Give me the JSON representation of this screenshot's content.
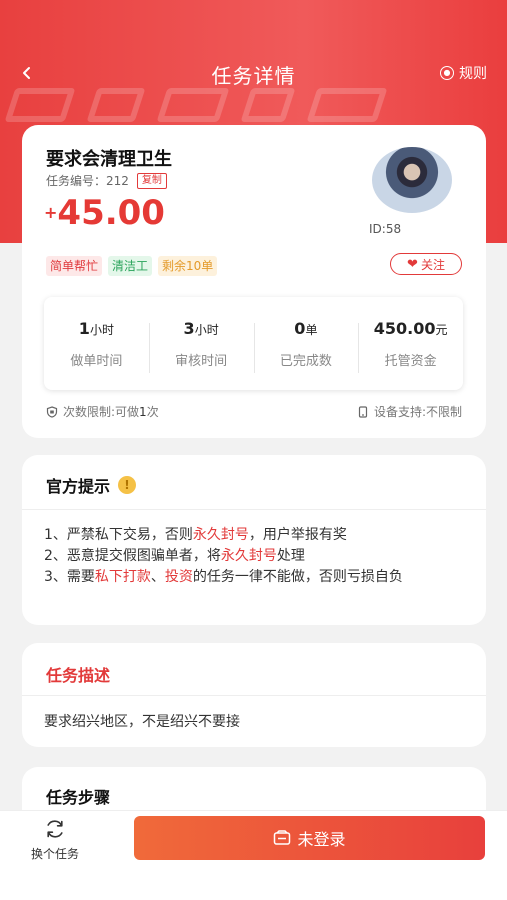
{
  "colors": {
    "brand_red": "#e8403f",
    "button_orange": "#f06a3a",
    "tag_green": "#29a35a",
    "tag_orange": "#e49b2b"
  },
  "header": {
    "title": "任务详情",
    "rules_label": "规则",
    "back_icon": "chevron-left-icon",
    "rules_icon": "rules-icon"
  },
  "task": {
    "title": "要求会清理卫生",
    "id_label": "任务编号：212",
    "copy_label": "复制",
    "reward_prefix": "+",
    "reward_amount": "45.00",
    "publisher_id": "ID:58",
    "tags": [
      "简单帮忙",
      "清洁工",
      "剩余10单"
    ],
    "follow_label": "关注",
    "stats": [
      {
        "value": "1",
        "unit": "小时",
        "label": "做单时间"
      },
      {
        "value": "3",
        "unit": "小时",
        "label": "审核时间"
      },
      {
        "value": "0",
        "unit": "单",
        "label": "已完成数"
      },
      {
        "value": "450.00",
        "unit": "元",
        "label": "托管资金"
      }
    ],
    "limit_prefix": "次数限制:可做",
    "limit_count": "1",
    "limit_suffix": "次",
    "device_label": "设备支持:不限制"
  },
  "notice": {
    "title": "官方提示",
    "line1_a": "1、严禁私下交易，否则",
    "line1_red": "永久封号",
    "line1_b": "，用户举报有奖",
    "line2_a": "2、恶意提交假图骗单者，将",
    "line2_red": "永久封号",
    "line2_b": "处理",
    "line3_a": "3、需要",
    "line3_red1": "私下打款",
    "line3_sep": "、",
    "line3_red2": "投资",
    "line3_b": "的任务一律不能做，否则亏损自负"
  },
  "description": {
    "title": "任务描述",
    "text": "要求绍兴地区，不是绍兴不要接"
  },
  "steps": {
    "title": "任务步骤"
  },
  "bottom": {
    "switch_label": "换个任务",
    "login_label": "未登录"
  }
}
